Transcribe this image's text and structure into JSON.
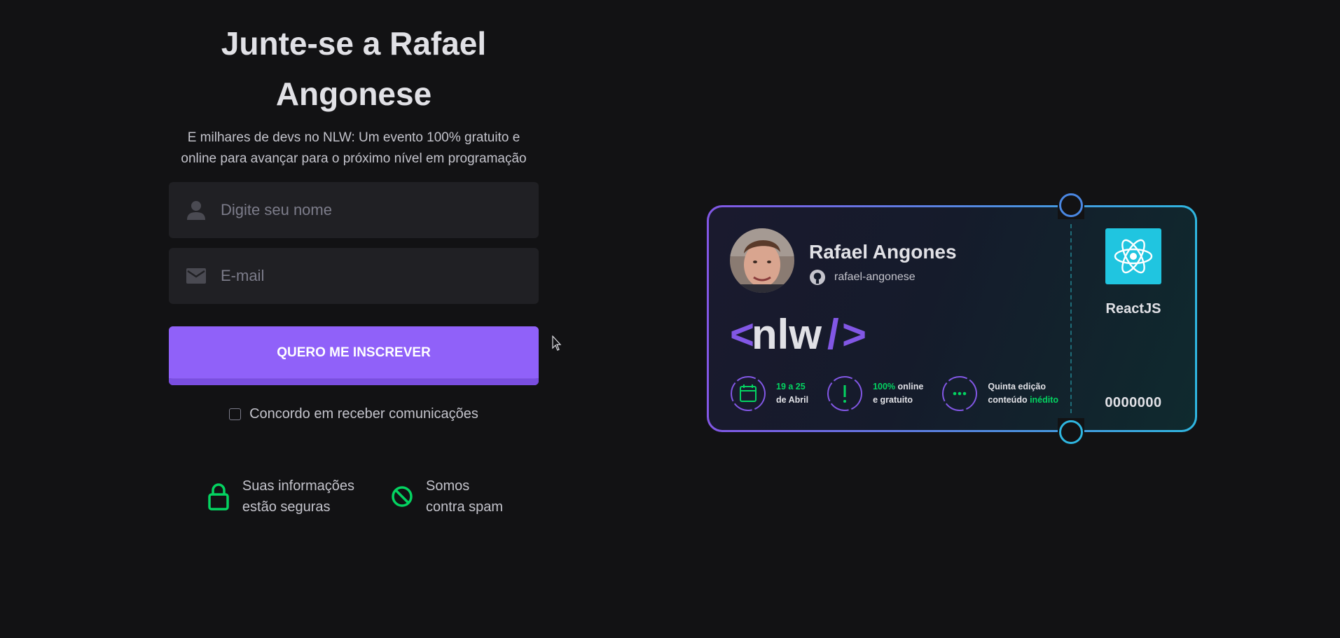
{
  "signup": {
    "title": "Junte-se a Rafael Angonese",
    "subtitle": "E milhares de devs no NLW: Um evento 100% gratuito e online para avançar para o próximo nível em programação",
    "name_placeholder": "Digite seu nome",
    "email_placeholder": "E-mail",
    "submit_label": "QUERO ME INSCREVER",
    "consent_label": "Concordo em receber comunicações",
    "consent_checked": false,
    "badges": [
      {
        "line1": "Suas informações",
        "line2": "estão seguras",
        "icon": "lock-icon"
      },
      {
        "line1": "Somos",
        "line2": "contra spam",
        "icon": "no-spam-icon"
      }
    ]
  },
  "ticket": {
    "user_name": "Rafael Angones",
    "github_user": "rafael-angonese",
    "logo": {
      "lt": "<",
      "text": "nlw",
      "slash": "/",
      "gt": ">"
    },
    "facts": [
      {
        "l1a": "19 a 25",
        "l1b": "",
        "l2a": "de Abril",
        "l2b": "",
        "icon": "calendar-icon"
      },
      {
        "l1a": "100%",
        "l1b": " online",
        "l2a": "e gratuito",
        "l2b": "",
        "icon": "exclamation-icon"
      },
      {
        "l1a": "Quinta edição",
        "l1b": "",
        "l2a": "conteúdo ",
        "l2b": "inédito",
        "icon": "dots-icon"
      }
    ],
    "tech": "ReactJS",
    "number": "0000000"
  },
  "colors": {
    "background": "#121214",
    "primary": "#8257e5",
    "accent_green": "#04d361",
    "react_cyan": "#20c5e0"
  }
}
